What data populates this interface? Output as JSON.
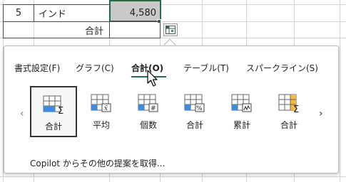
{
  "sheet": {
    "row_number": "5",
    "country": "インド",
    "value": "4,580",
    "total_label": "合計"
  },
  "panel": {
    "tabs": [
      {
        "label": "書式設定(F)"
      },
      {
        "label": "グラフ(C)"
      },
      {
        "label": "合計(O)",
        "active": true
      },
      {
        "label": "テーブル(T)"
      },
      {
        "label": "スパークライン(S)"
      }
    ],
    "items": [
      {
        "icon": "sum-icon",
        "label": "合計",
        "selected": true
      },
      {
        "icon": "average-icon",
        "label": "平均"
      },
      {
        "icon": "count-icon",
        "label": "個数"
      },
      {
        "icon": "percent-total-icon",
        "label": "合計"
      },
      {
        "icon": "running-total-icon",
        "label": "累計"
      },
      {
        "icon": "column-sum-icon",
        "label": "合計"
      }
    ],
    "prev_arrow": "‹",
    "next_arrow": "›",
    "copilot_text": "Copilot からその他の提案を取得..."
  },
  "colors": {
    "accent": "#1e7145",
    "icon_blue": "#3c8dde",
    "icon_orange": "#f4b942",
    "selected_fill": "#c9c9c9"
  }
}
